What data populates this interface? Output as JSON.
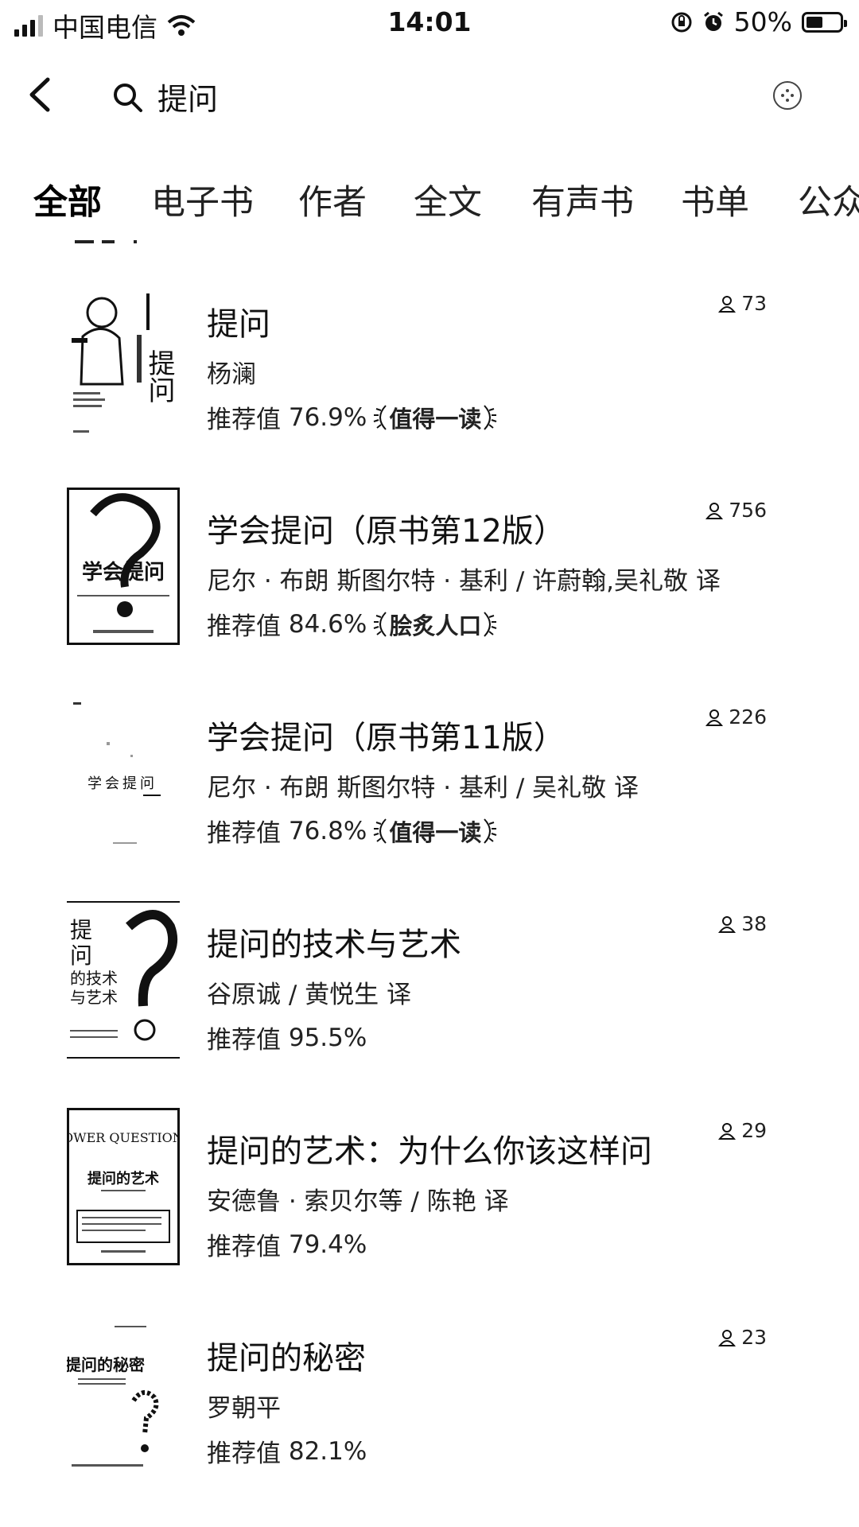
{
  "status": {
    "carrier": "中国电信",
    "time": "14:01",
    "battery_text": "50%",
    "battery_level": 0.5
  },
  "search": {
    "query": "提问"
  },
  "tabs": [
    {
      "label": "全部",
      "active": true
    },
    {
      "label": "电子书",
      "active": false
    },
    {
      "label": "作者",
      "active": false
    },
    {
      "label": "全文",
      "active": false
    },
    {
      "label": "有声书",
      "active": false
    },
    {
      "label": "书单",
      "active": false
    },
    {
      "label": "公众",
      "active": false
    }
  ],
  "books": [
    {
      "title": "提问",
      "author": "杨澜",
      "rating_label": "推荐值",
      "rating": "76.9%",
      "badge": "值得一读",
      "readers": "73",
      "cover_text": "提问"
    },
    {
      "title": "学会提问（原书第12版）",
      "author": "尼尔 · 布朗 斯图尔特 · 基利 / 许蔚翰,吴礼敬 译",
      "rating_label": "推荐值",
      "rating": "84.6%",
      "badge": "脍炙人口",
      "readers": "756",
      "cover_text": "学会提问"
    },
    {
      "title": "学会提问（原书第11版）",
      "author": "尼尔 · 布朗 斯图尔特 · 基利 / 吴礼敬 译",
      "rating_label": "推荐值",
      "rating": "76.8%",
      "badge": "值得一读",
      "readers": "226",
      "cover_text": "学会提问"
    },
    {
      "title": "提问的技术与艺术",
      "author": "谷原诚 / 黄悦生 译",
      "rating_label": "推荐值",
      "rating": "95.5%",
      "badge": "",
      "readers": "38",
      "cover_text": "提问的技术与艺术"
    },
    {
      "title": "提问的艺术：为什么你该这样问",
      "author": "安德鲁 · 索贝尔等 / 陈艳 译",
      "rating_label": "推荐值",
      "rating": "79.4%",
      "badge": "",
      "readers": "29",
      "cover_text": "POWER QUESTIONS",
      "cover_subtext": "提问的艺术"
    },
    {
      "title": "提问的秘密",
      "author": "罗朝平",
      "rating_label": "推荐值",
      "rating": "82.1%",
      "badge": "",
      "readers": "23",
      "cover_text": "提问的秘密"
    }
  ]
}
